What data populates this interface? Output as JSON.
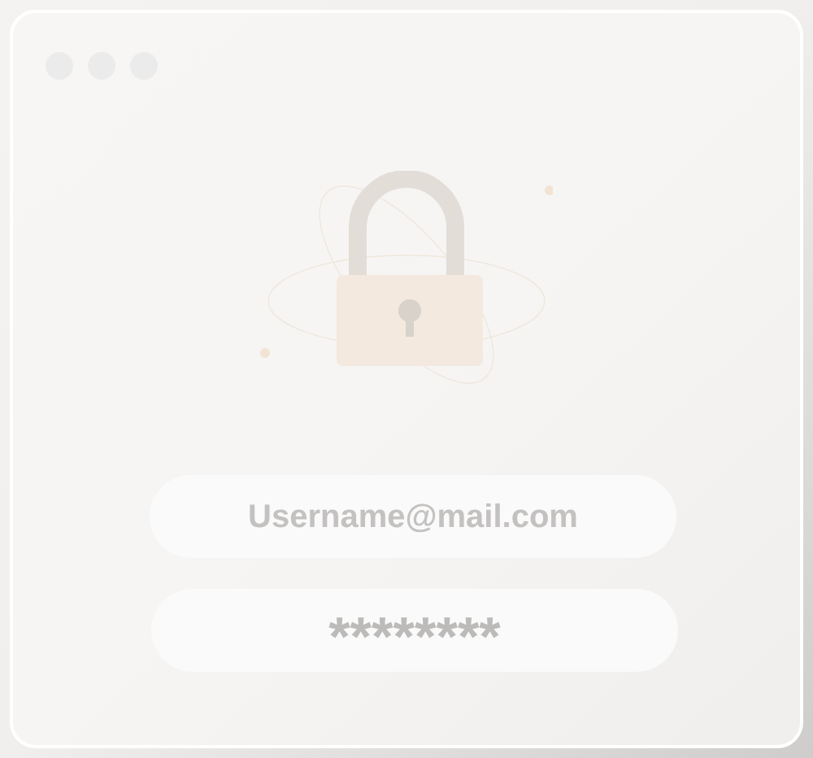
{
  "login_form": {
    "username": "Username@mail.com",
    "password": "********"
  }
}
